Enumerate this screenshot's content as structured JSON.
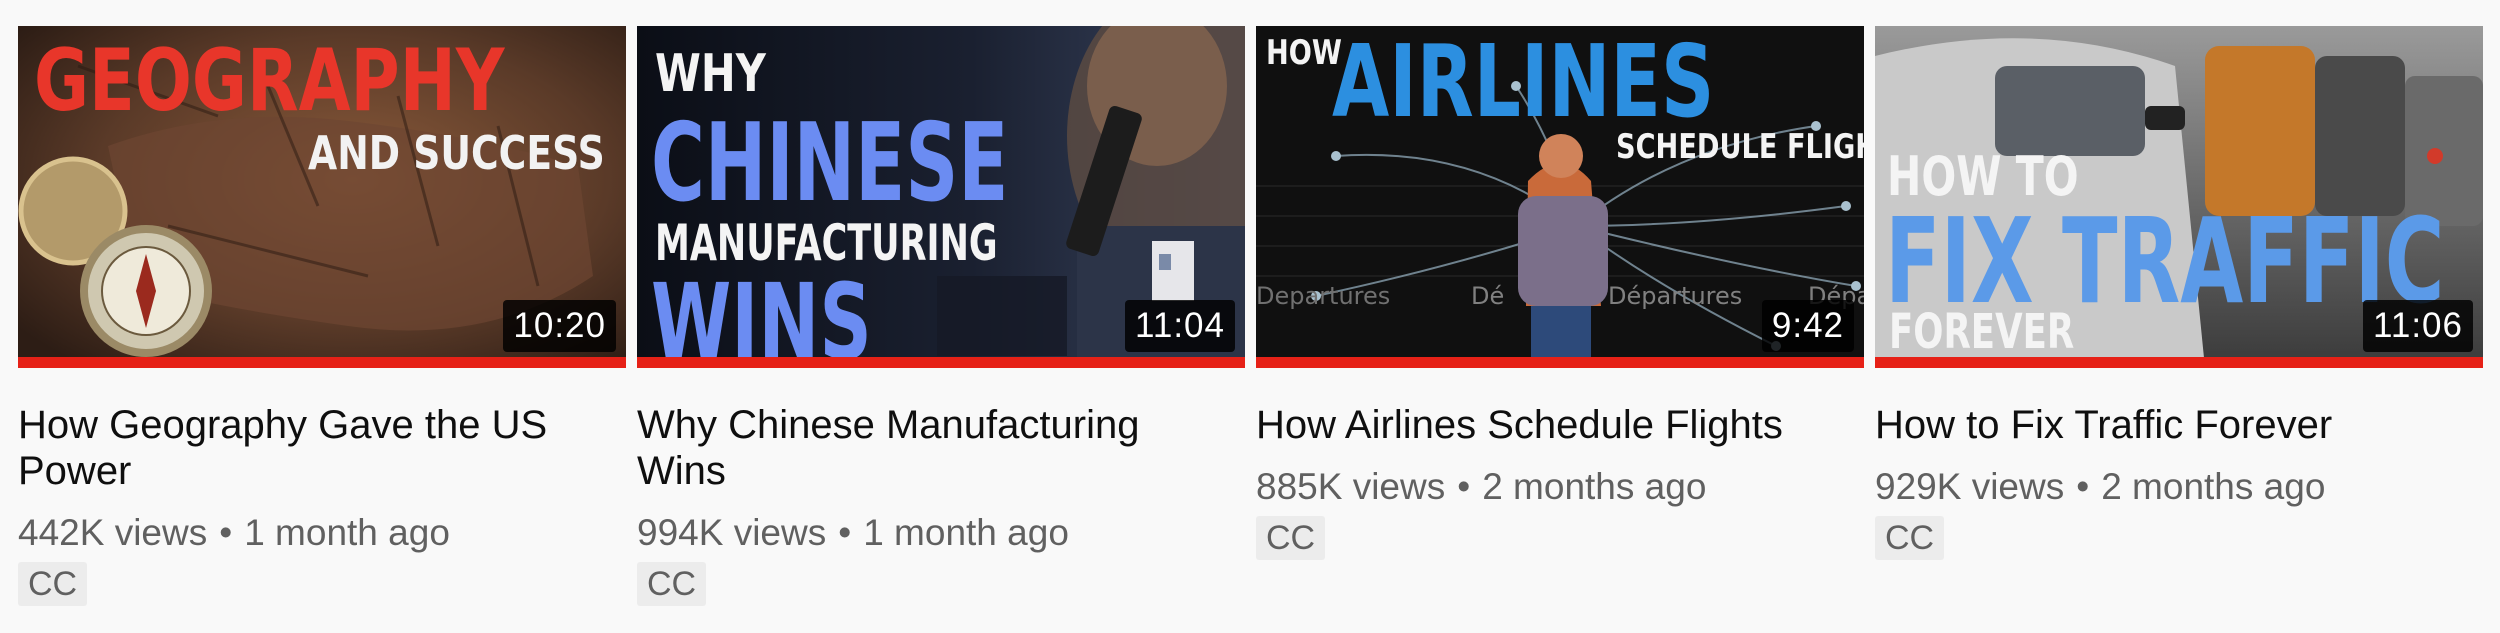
{
  "videos": [
    {
      "title": "How Geography Gave the US Power",
      "views": "442K views",
      "age": "1 month ago",
      "badge": "CC",
      "duration": "10:20",
      "watched_fraction": 1.0,
      "thumb_text": {
        "line1": "GEOGRAPHY",
        "line2": "AND SUCCESS"
      }
    },
    {
      "title": "Why Chinese Manufacturing Wins",
      "views": "994K views",
      "age": "1 month ago",
      "badge": "CC",
      "duration": "11:04",
      "watched_fraction": 1.0,
      "thumb_text": {
        "line1": "WHY",
        "line2": "CHINESE",
        "line3": "MANUFACTURING",
        "line4": "WINS"
      }
    },
    {
      "title": "How Airlines Schedule Flights",
      "views": "885K views",
      "age": "2 months ago",
      "badge": "CC",
      "duration": "9:42",
      "watched_fraction": 1.0,
      "thumb_text": {
        "line1": "HOW",
        "line2": "AIRLINES",
        "line3": "SCHEDULE FLIGHTS",
        "board1": "Departures",
        "board2": "Dé",
        "board3": "Départures",
        "board4": "Dépa"
      }
    },
    {
      "title": "How to Fix Traffic Forever",
      "views": "929K views",
      "age": "2 months ago",
      "badge": "CC",
      "duration": "11:06",
      "watched_fraction": 1.0,
      "thumb_text": {
        "line1": "HOW TO",
        "line2": "FIX TRAFFIC",
        "line3": "FOREVER"
      }
    }
  ],
  "meta_separator": "•",
  "colors": {
    "progress": "#e62117",
    "title": "#0f0f0f",
    "meta": "#606060",
    "badge_bg": "#ececec"
  }
}
